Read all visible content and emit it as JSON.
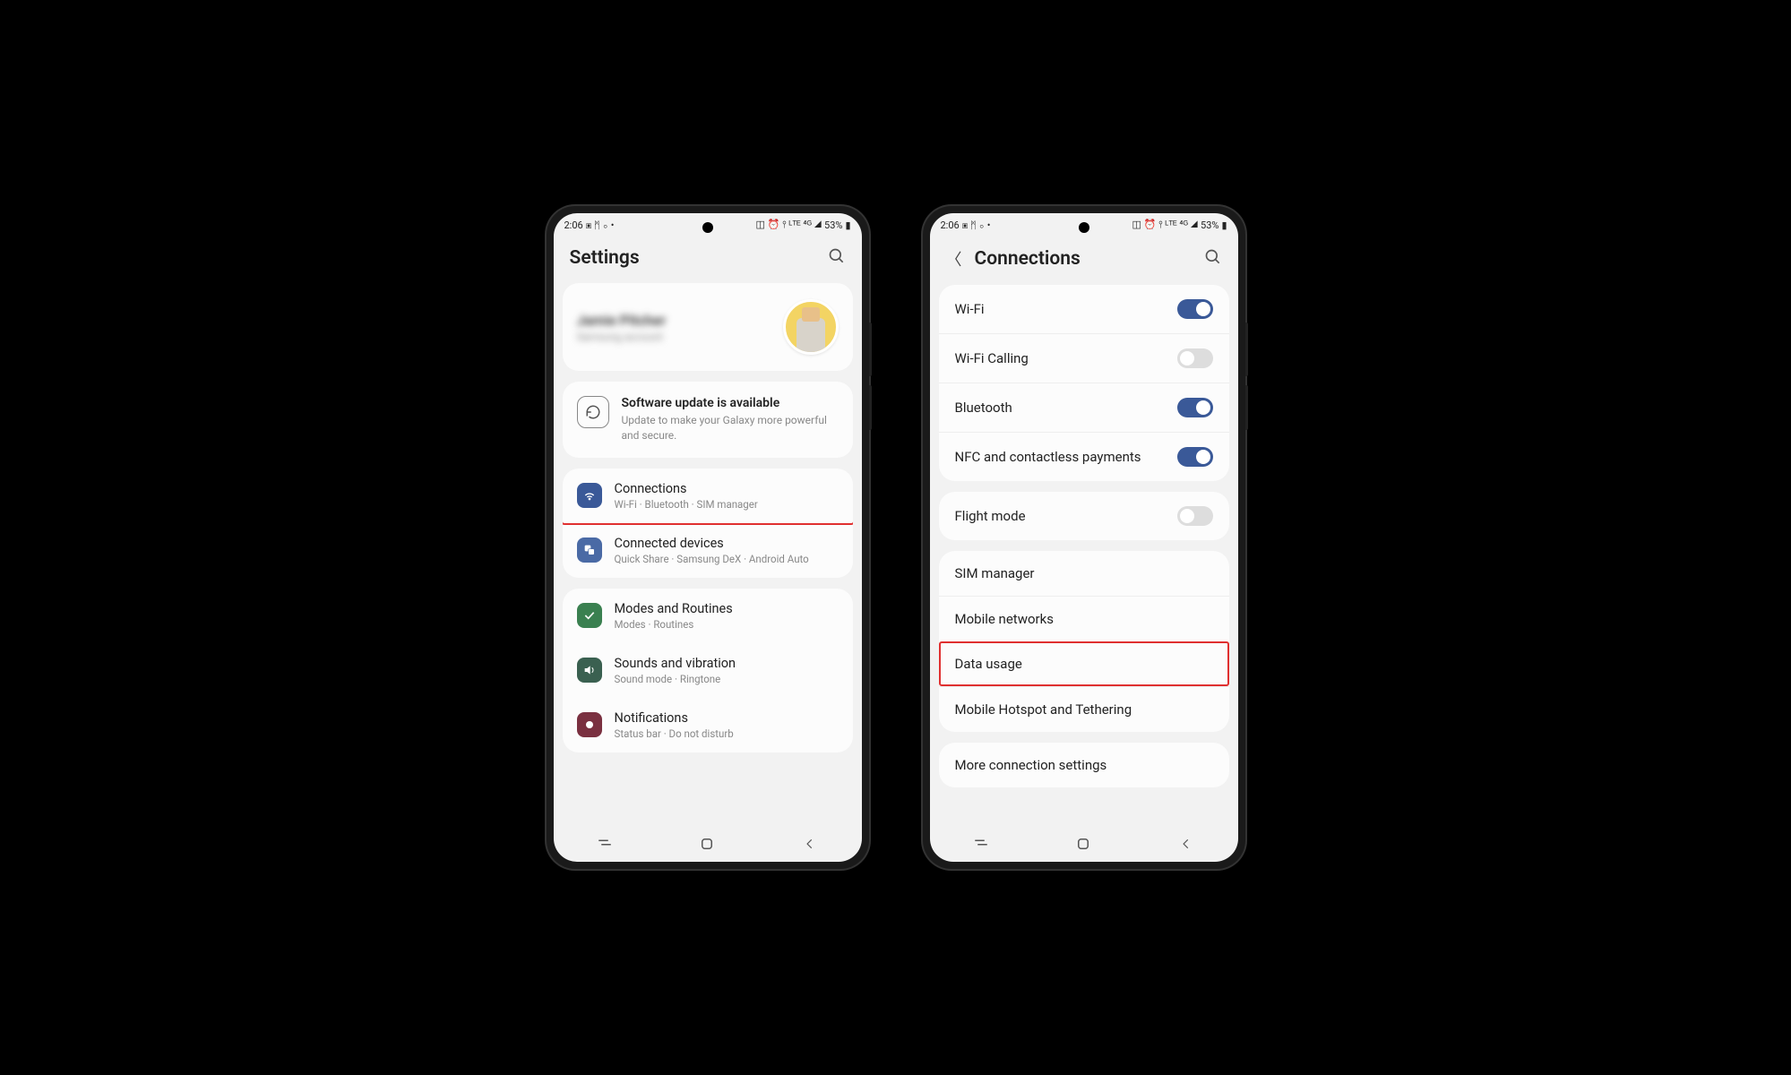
{
  "statusbar": {
    "time": "2:06",
    "battery": "53%"
  },
  "phone1": {
    "title": "Settings",
    "profile": {
      "name": "Jamie Pitcher",
      "sub": "Samsung account"
    },
    "update": {
      "title": "Software update is available",
      "desc": "Update to make your Galaxy more powerful and secure."
    },
    "items": [
      {
        "title": "Connections",
        "desc": "Wi-Fi · Bluetooth · SIM manager"
      },
      {
        "title": "Connected devices",
        "desc": "Quick Share · Samsung DeX · Android Auto"
      },
      {
        "title": "Modes and Routines",
        "desc": "Modes · Routines"
      },
      {
        "title": "Sounds and vibration",
        "desc": "Sound mode · Ringtone"
      },
      {
        "title": "Notifications",
        "desc": "Status bar · Do not disturb"
      }
    ]
  },
  "phone2": {
    "title": "Connections",
    "groups": [
      [
        {
          "label": "Wi-Fi",
          "toggle": "on"
        },
        {
          "label": "Wi-Fi Calling",
          "toggle": "off"
        },
        {
          "label": "Bluetooth",
          "toggle": "on"
        },
        {
          "label": "NFC and contactless payments",
          "toggle": "on"
        }
      ],
      [
        {
          "label": "Flight mode",
          "toggle": "off"
        }
      ],
      [
        {
          "label": "SIM manager"
        },
        {
          "label": "Mobile networks"
        },
        {
          "label": "Data usage",
          "highlight": true
        },
        {
          "label": "Mobile Hotspot and Tethering"
        }
      ],
      [
        {
          "label": "More connection settings"
        }
      ]
    ]
  }
}
